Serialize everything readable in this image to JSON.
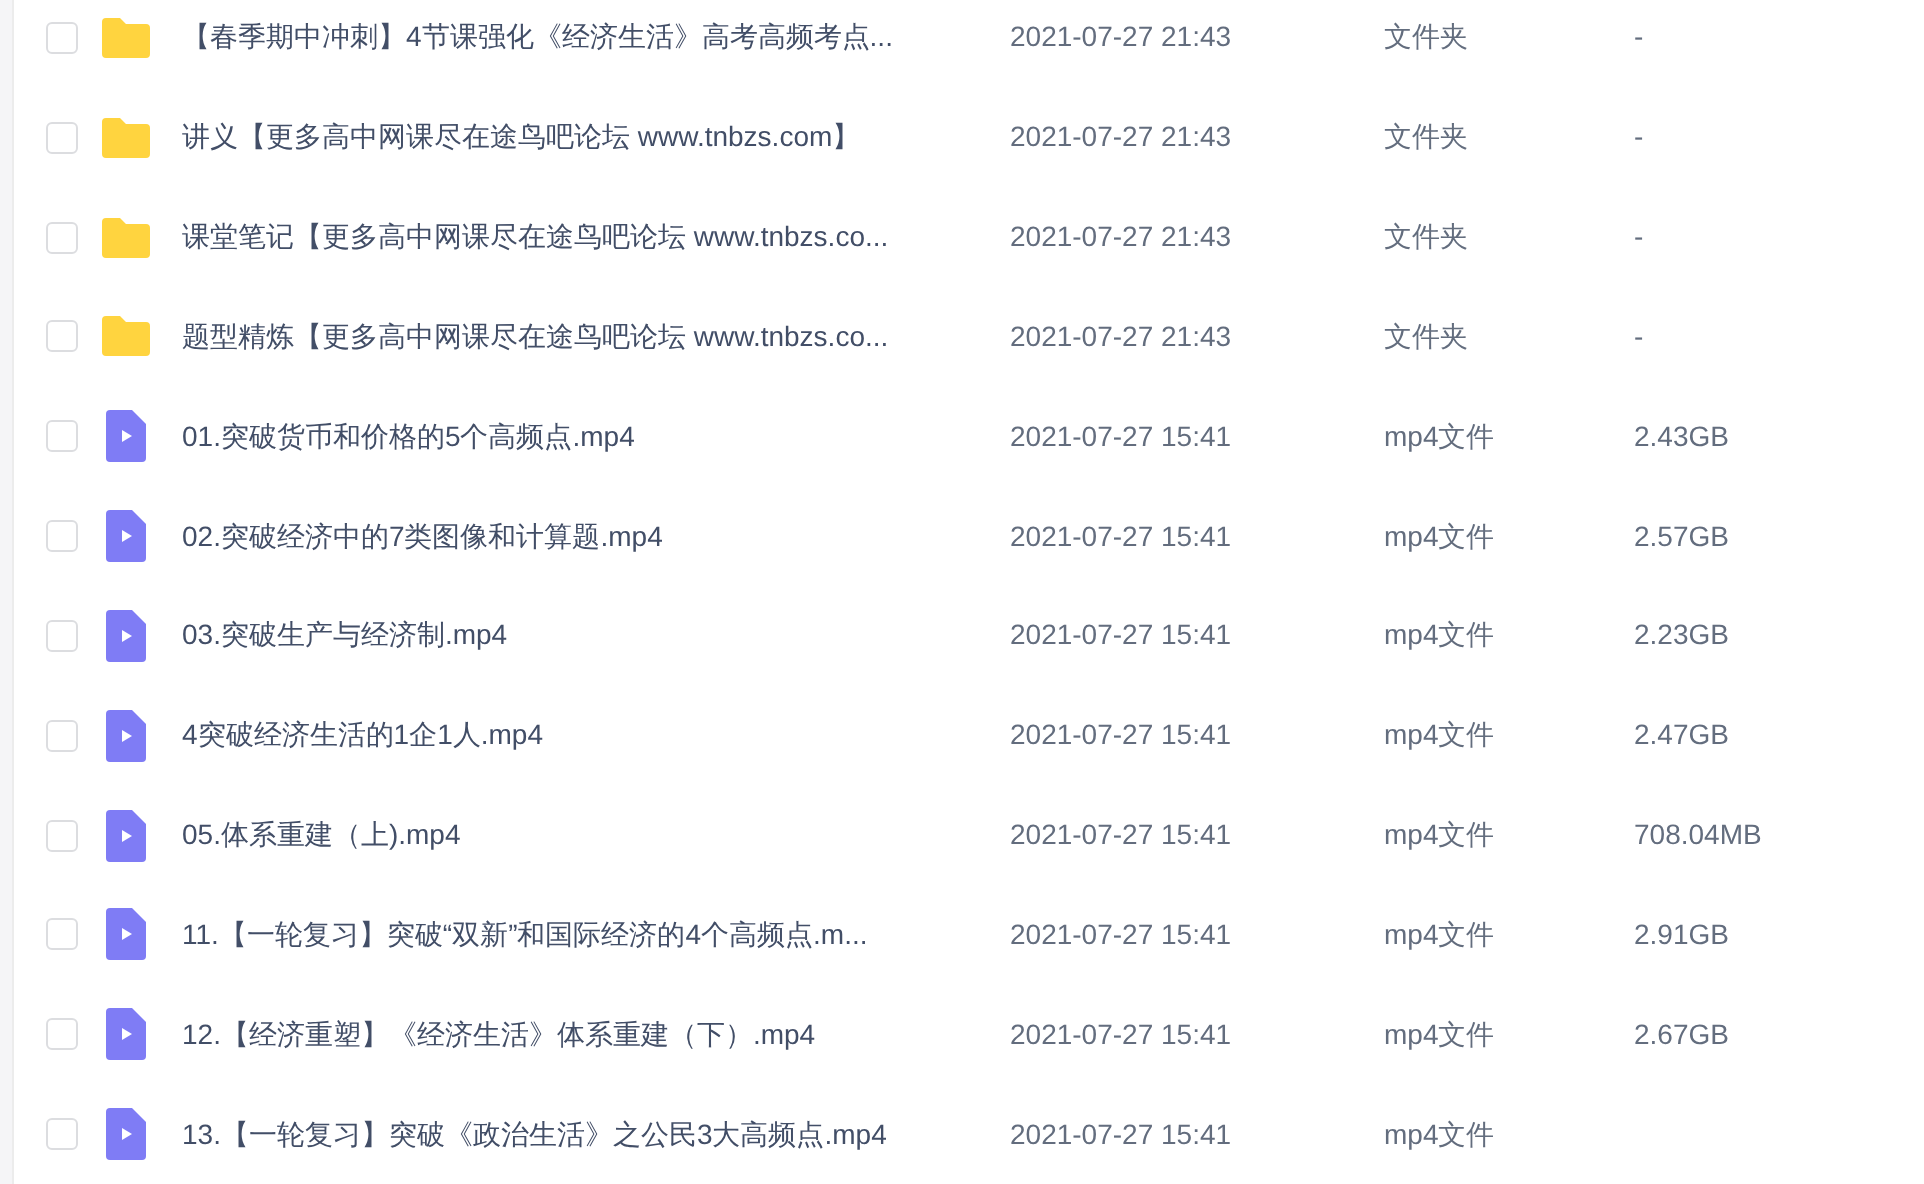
{
  "files": [
    {
      "kind": "folder",
      "checked": false,
      "name": "【春季期中冲刺】4节课强化《经济生活》高考高频考点...",
      "date": "2021-07-27 21:43",
      "type": "文件夹",
      "size": "-"
    },
    {
      "kind": "folder",
      "checked": false,
      "name": "讲义【更多高中网课尽在途鸟吧论坛 www.tnbzs.com】",
      "date": "2021-07-27 21:43",
      "type": "文件夹",
      "size": "-"
    },
    {
      "kind": "folder",
      "checked": false,
      "name": "课堂笔记【更多高中网课尽在途鸟吧论坛 www.tnbzs.co...",
      "date": "2021-07-27 21:43",
      "type": "文件夹",
      "size": "-"
    },
    {
      "kind": "folder",
      "checked": false,
      "name": "题型精炼【更多高中网课尽在途鸟吧论坛 www.tnbzs.co...",
      "date": "2021-07-27 21:43",
      "type": "文件夹",
      "size": "-"
    },
    {
      "kind": "video",
      "checked": false,
      "name": "01.突破货币和价格的5个高频点.mp4",
      "date": "2021-07-27 15:41",
      "type": "mp4文件",
      "size": "2.43GB"
    },
    {
      "kind": "video",
      "checked": false,
      "name": "02.突破经济中的7类图像和计算题.mp4",
      "date": "2021-07-27 15:41",
      "type": "mp4文件",
      "size": "2.57GB"
    },
    {
      "kind": "video",
      "checked": false,
      "name": "03.突破生产与经济制.mp4",
      "date": "2021-07-27 15:41",
      "type": "mp4文件",
      "size": "2.23GB"
    },
    {
      "kind": "video",
      "checked": false,
      "name": "4突破经济生活的1企1人.mp4",
      "date": "2021-07-27 15:41",
      "type": "mp4文件",
      "size": "2.47GB"
    },
    {
      "kind": "video",
      "checked": false,
      "name": "05.体系重建（上).mp4",
      "date": "2021-07-27 15:41",
      "type": "mp4文件",
      "size": "708.04MB"
    },
    {
      "kind": "video",
      "checked": false,
      "name": "11.【一轮复习】突破“双新”和国际经济的4个高频点.m...",
      "date": "2021-07-27 15:41",
      "type": "mp4文件",
      "size": "2.91GB"
    },
    {
      "kind": "video",
      "checked": false,
      "name": "12.【经济重塑】《经济生活》体系重建（下）.mp4",
      "date": "2021-07-27 15:41",
      "type": "mp4文件",
      "size": "2.67GB"
    },
    {
      "kind": "video",
      "checked": false,
      "name": "13.【一轮复习】突破《政治生活》之公民3大高频点.mp4",
      "date": "2021-07-27 15:41",
      "type": "mp4文件"
    }
  ]
}
